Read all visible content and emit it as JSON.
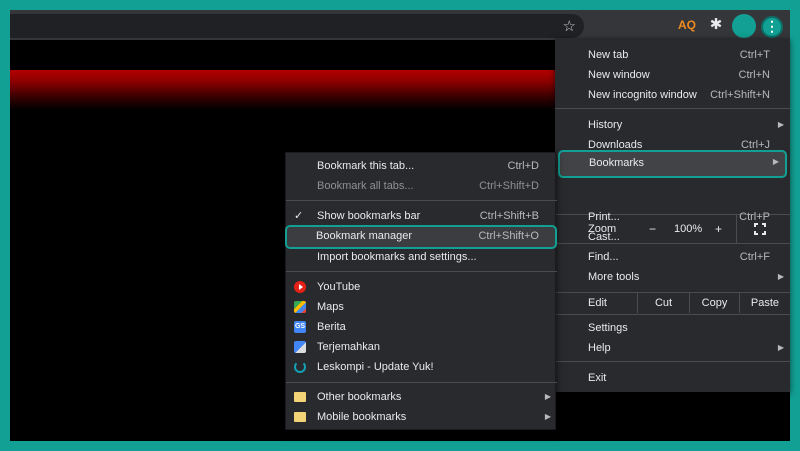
{
  "browser": {
    "star_icon": "star-icon",
    "ext_icon": "extension-icon",
    "ext_label": "AQ",
    "puzzle_icon": "puzzle-icon",
    "menu_icon": "⋮"
  },
  "chrome_menu": {
    "new_tab": {
      "label": "New tab",
      "shortcut": "Ctrl+T"
    },
    "new_window": {
      "label": "New window",
      "shortcut": "Ctrl+N"
    },
    "new_incognito": {
      "label": "New incognito window",
      "shortcut": "Ctrl+Shift+N"
    },
    "history": {
      "label": "History"
    },
    "downloads": {
      "label": "Downloads",
      "shortcut": "Ctrl+J"
    },
    "bookmarks": {
      "label": "Bookmarks"
    },
    "zoom": {
      "label": "Zoom",
      "minus": "−",
      "value": "100%",
      "plus": "+"
    },
    "print": {
      "label": "Print...",
      "shortcut": "Ctrl+P"
    },
    "cast": {
      "label": "Cast..."
    },
    "find": {
      "label": "Find...",
      "shortcut": "Ctrl+F"
    },
    "more_tools": {
      "label": "More tools"
    },
    "edit": {
      "label": "Edit",
      "cut": "Cut",
      "copy": "Copy",
      "paste": "Paste"
    },
    "settings": {
      "label": "Settings"
    },
    "help": {
      "label": "Help"
    },
    "exit": {
      "label": "Exit"
    }
  },
  "bookmarks_menu": {
    "bookmark_tab": {
      "label": "Bookmark this tab...",
      "shortcut": "Ctrl+D"
    },
    "bookmark_all": {
      "label": "Bookmark all tabs...",
      "shortcut": "Ctrl+Shift+D"
    },
    "show_bar": {
      "label": "Show bookmarks bar",
      "shortcut": "Ctrl+Shift+B"
    },
    "manager": {
      "label": "Bookmark manager",
      "shortcut": "Ctrl+Shift+O"
    },
    "import": {
      "label": "Import bookmarks and settings..."
    },
    "items": [
      {
        "label": "YouTube",
        "icon": "youtube-icon"
      },
      {
        "label": "Maps",
        "icon": "maps-icon"
      },
      {
        "label": "Berita",
        "icon": "news-icon",
        "glyph": "GS"
      },
      {
        "label": "Terjemahkan",
        "icon": "translate-icon"
      },
      {
        "label": "Leskompi - Update Yuk!",
        "icon": "leskompi-icon"
      }
    ],
    "other": {
      "label": "Other bookmarks"
    },
    "mobile": {
      "label": "Mobile bookmarks"
    }
  },
  "colors": {
    "highlight": "#12a094",
    "menu_bg": "#292a2d",
    "toolbar_bg": "#35363a"
  }
}
